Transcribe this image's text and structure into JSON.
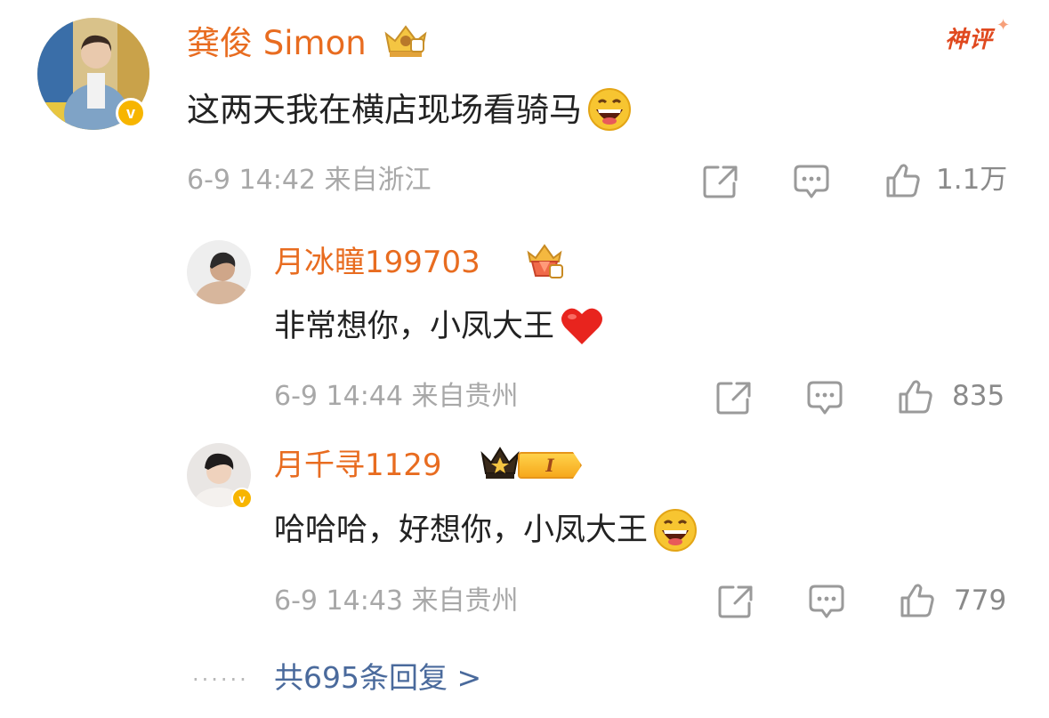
{
  "main_comment": {
    "username": "龚俊 Simon",
    "content": "这两天我在横店现场看骑马",
    "emoji": "grin-emoji",
    "meta": "6-9 14:42 来自浙江",
    "like_count": "1.1万",
    "badge": "神评"
  },
  "replies": [
    {
      "username": "月冰瞳199703",
      "content": "非常想你，小凤大王",
      "emoji": "heart-emoji",
      "meta": "6-9 14:44 来自贵州",
      "like_count": "835"
    },
    {
      "username": "月千寻1129",
      "content": "哈哈哈，好想你，小凤大王",
      "emoji": "grin-emoji",
      "meta": "6-9 14:43 来自贵州",
      "like_count": "779",
      "level": "I"
    }
  ],
  "more_replies": "共695条回复 >",
  "colors": {
    "username": "#e86c20",
    "meta": "#a8a8a8",
    "link": "#4a6a9c",
    "verified": "#f7b500"
  },
  "verified_mark": "v"
}
